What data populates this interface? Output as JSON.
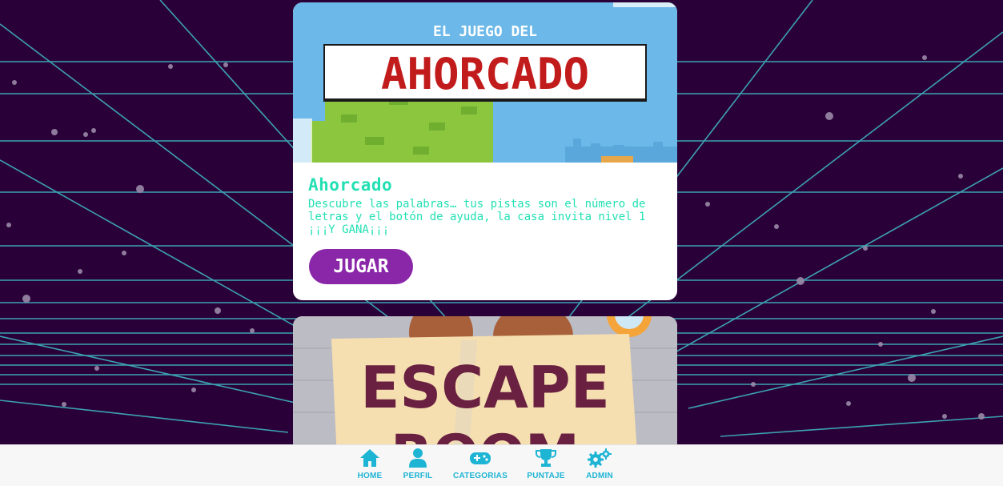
{
  "games": [
    {
      "banner_small": "EL JUEGO DEL",
      "banner_big": "AHORCADO",
      "title": "Ahorcado",
      "description": "Descubre las palabras… tus pistas son el número de letras y el botón de ayuda, la casa invita nivel 1 ¡¡¡Y GANA¡¡¡",
      "button_label": "JUGAR"
    },
    {
      "banner_big": "ESCAPE",
      "banner_second": "ROOM"
    }
  ],
  "nav": {
    "items": [
      {
        "label": "HOME",
        "icon": "home-icon"
      },
      {
        "label": "PERFIL",
        "icon": "user-icon"
      },
      {
        "label": "CATEGORIAS",
        "icon": "gamepad-icon"
      },
      {
        "label": "PUNTAJE",
        "icon": "trophy-icon"
      },
      {
        "label": "ADMIN",
        "icon": "gears-icon"
      }
    ]
  },
  "colors": {
    "background": "#2a0038",
    "grid_lines": "#3fbfc7",
    "accent_text": "#22e0b4",
    "button": "#8a27a8",
    "nav_icon": "#1eb4d4"
  }
}
